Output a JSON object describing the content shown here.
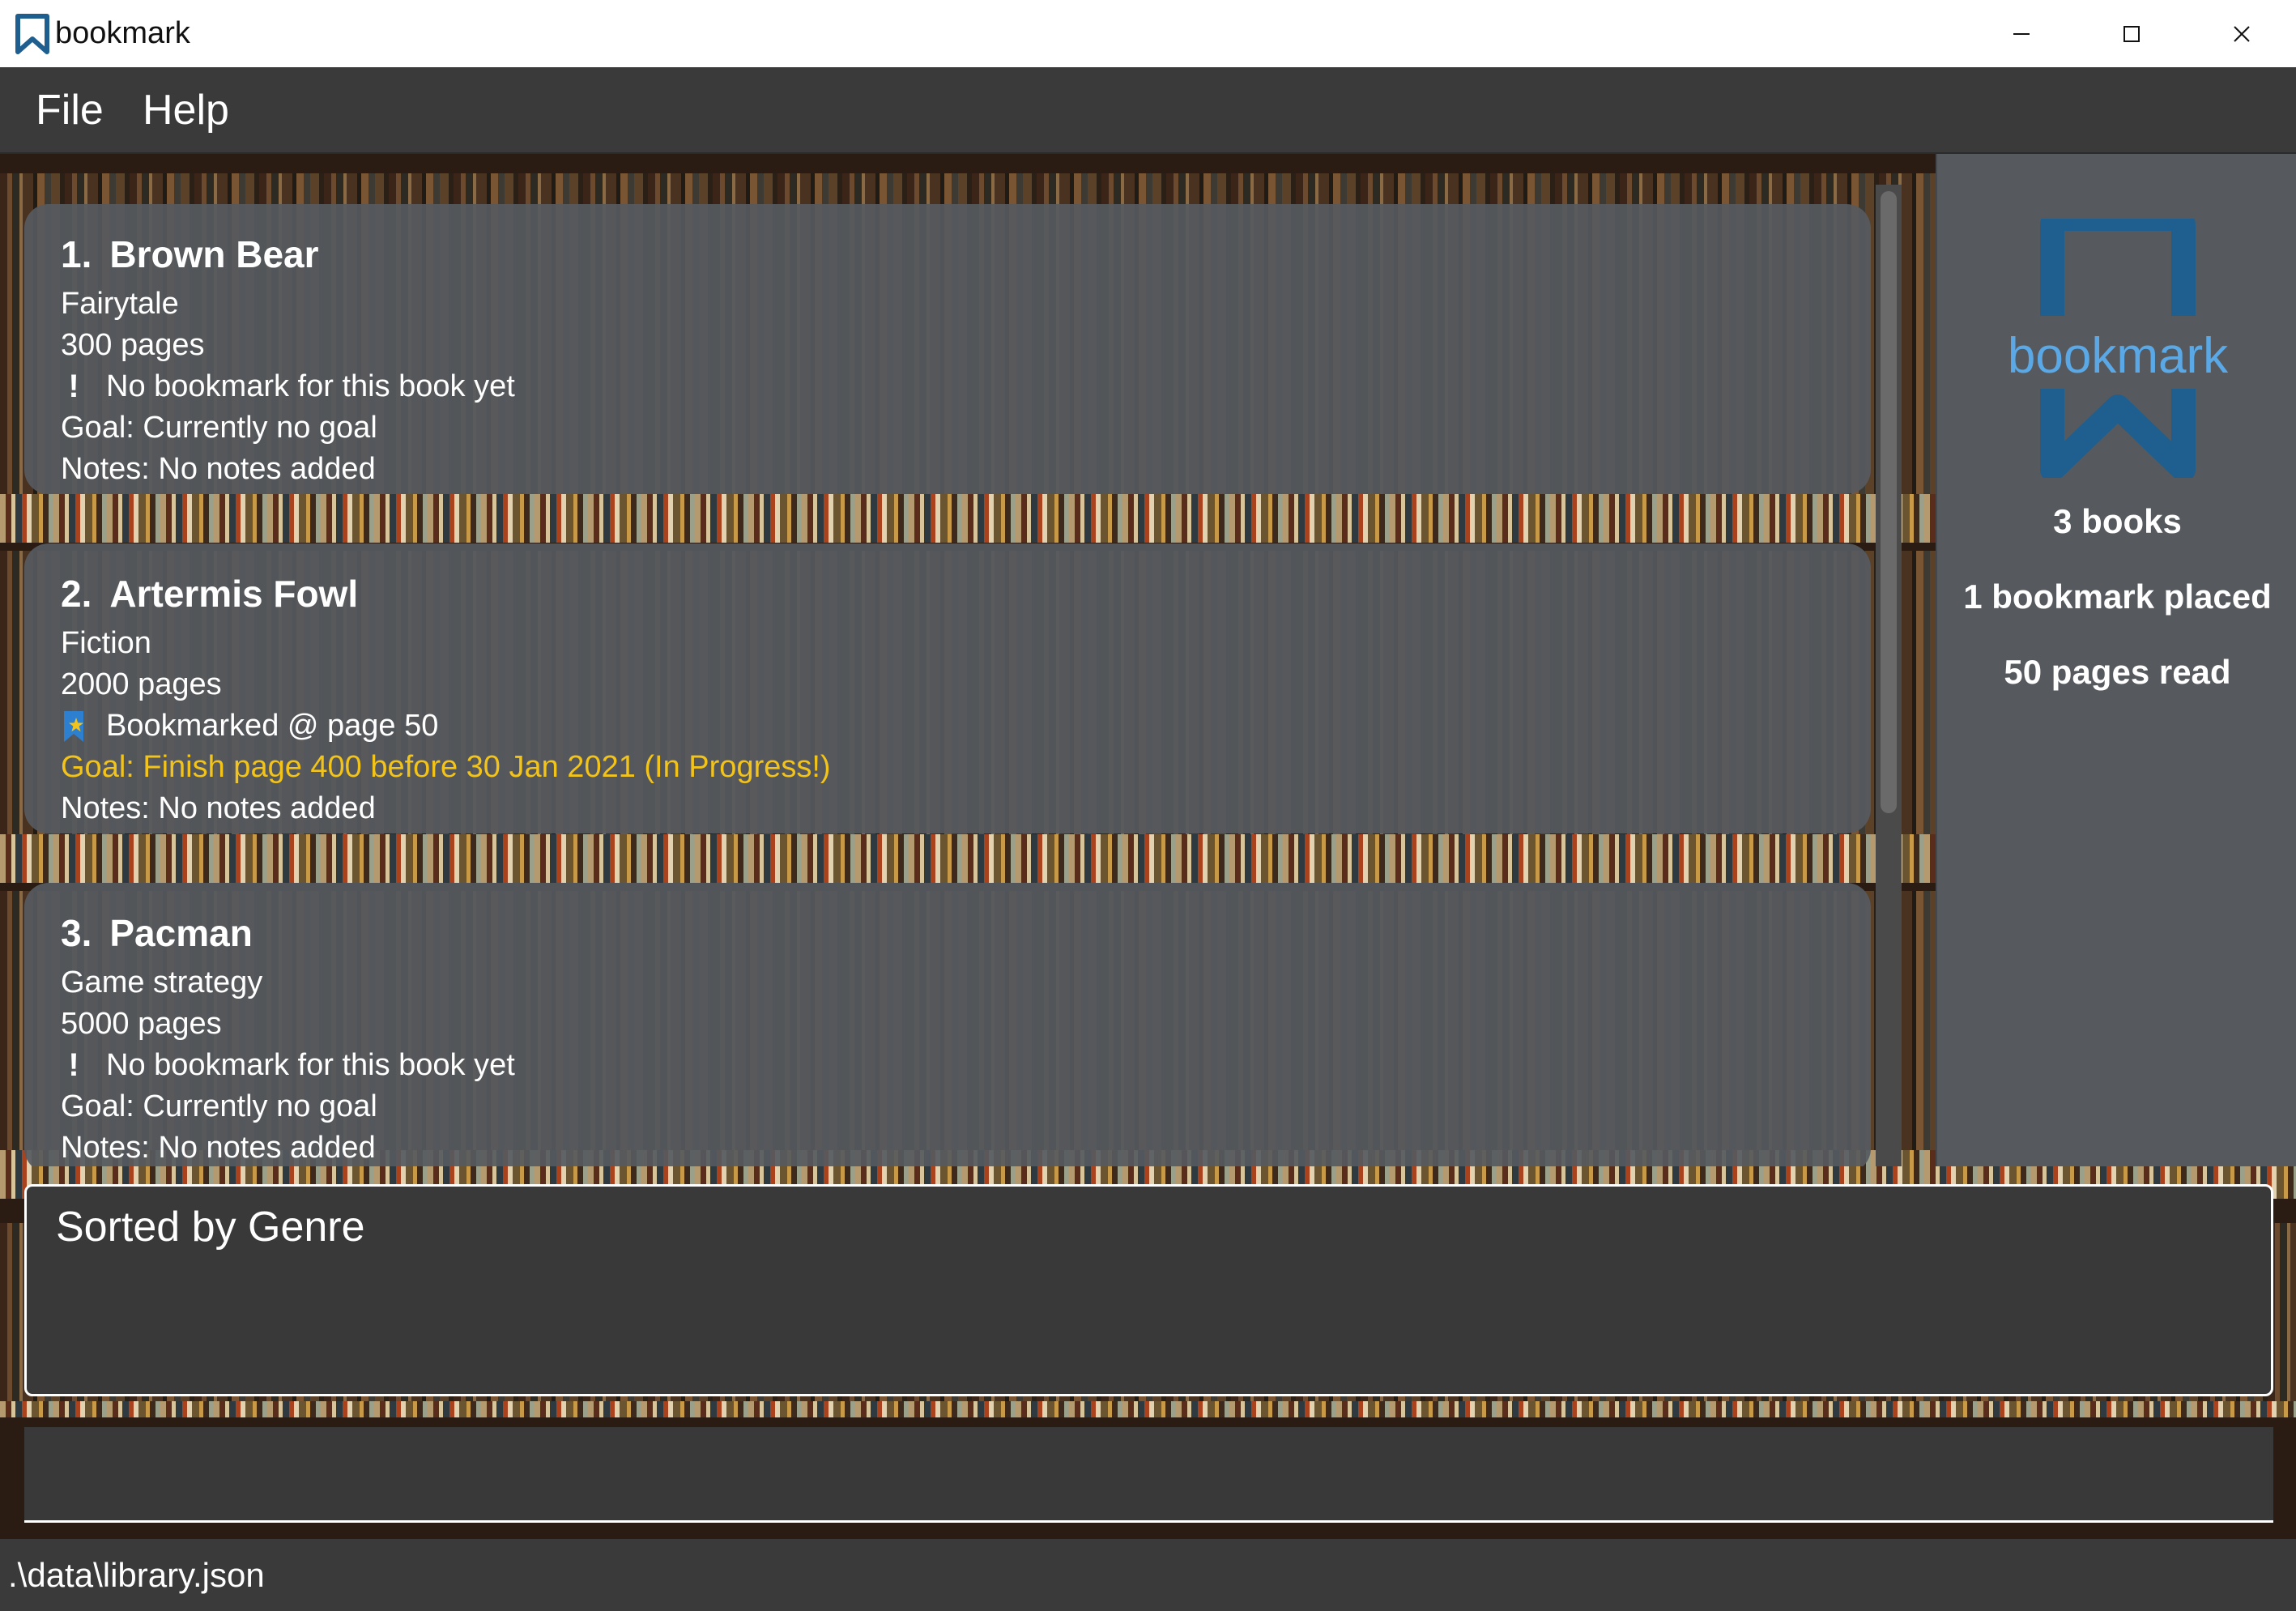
{
  "window": {
    "title": "bookmark",
    "controls": [
      "minimize",
      "maximize",
      "close"
    ]
  },
  "menu": {
    "file": "File",
    "help": "Help"
  },
  "books": [
    {
      "index": "1.",
      "title": "Brown Bear",
      "genre": "Fairytale",
      "pages": "300 pages",
      "bookmark_icon": "exclamation-icon",
      "bookmark": "No bookmark for this book yet",
      "goal": "Goal: Currently no goal",
      "goal_in_progress": false,
      "notes": "Notes: No notes added"
    },
    {
      "index": "2.",
      "title": "Artermis Fowl",
      "genre": "Fiction",
      "pages": "2000 pages",
      "bookmark_icon": "bookmark-star-icon",
      "bookmark": "Bookmarked @ page 50",
      "goal": "Goal: Finish page 400 before 30 Jan 2021 (In Progress!)",
      "goal_in_progress": true,
      "notes": "Notes: No notes added"
    },
    {
      "index": "3.",
      "title": "Pacman",
      "genre": "Game strategy",
      "pages": "5000 pages",
      "bookmark_icon": "exclamation-icon",
      "bookmark": "No bookmark for this book yet",
      "goal": "Goal: Currently no goal",
      "goal_in_progress": false,
      "notes": "Notes: No notes added"
    }
  ],
  "stats": {
    "logo_text": "bookmark",
    "books": "3 books",
    "bookmarks": "1 bookmark placed",
    "pages_read": "50 pages read"
  },
  "result": {
    "text": "Sorted by Genre"
  },
  "command": {
    "value": ""
  },
  "status": {
    "path": ".\\data\\library.json"
  },
  "colors": {
    "goal_in_progress": "#f2c31a",
    "logo_blue": "#1f5f8f",
    "logo_text": "#5aa8e6",
    "card_bg": "#565a60",
    "panel_bg": "#565a5f"
  }
}
